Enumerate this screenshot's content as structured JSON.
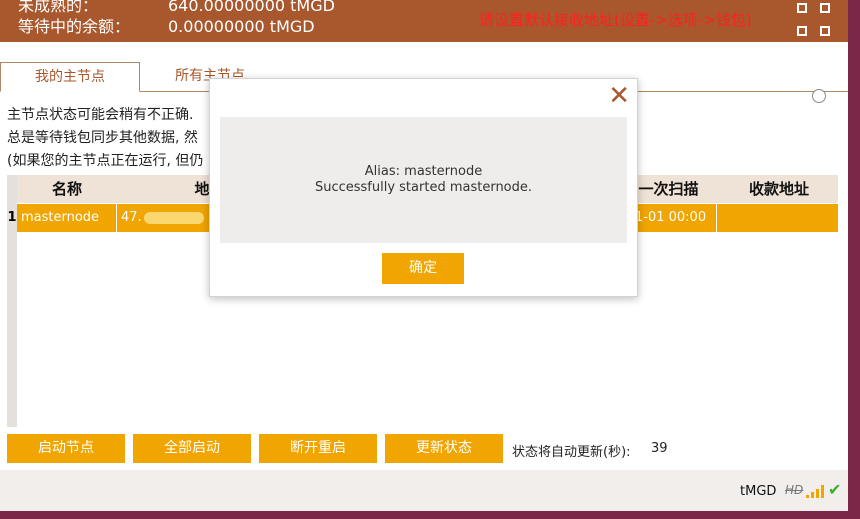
{
  "header": {
    "row1_label": "未成熟的：",
    "row1_value": "640.00000000 tMGD",
    "row2_label": "等待中的余额：",
    "row2_value": "0.00000000 tMGD",
    "notice": "请设置默认接收地址(设置->选项->钱包)",
    "qr_icon": "qr-code-icon"
  },
  "tabs": [
    {
      "label": "我的主节点"
    },
    {
      "label": "所有主节点"
    }
  ],
  "info_lines": [
    "主节点状态可能会稍有不正确.",
    "总是等待钱包同步其他数据, 然",
    "(如果您的主节点正在运行, 但仍"
  ],
  "table": {
    "headers": {
      "name": "名称",
      "address": "地",
      "last_seen": "一次扫描",
      "payee": "收款地址"
    },
    "rows": [
      {
        "index": "1",
        "name": "masternode",
        "address": "47.",
        "last_seen": "1-01 00:00",
        "payee": ""
      }
    ]
  },
  "buttons": {
    "start": "启动节点",
    "start_all": "全部启动",
    "restart": "断开重启",
    "update": "更新状态"
  },
  "auto_update": {
    "label": "状态将自动更新(秒):",
    "seconds": "39"
  },
  "statusbar": {
    "currency": "tMGD",
    "hd": "HD"
  },
  "dialog": {
    "line1": "Alias: masternode",
    "line2": "Successfully started masternode.",
    "ok": "确定"
  },
  "colors": {
    "accent": "#f0a500",
    "header_bg": "#a9572d",
    "notice": "#ff2020",
    "desktop": "#7b2748"
  }
}
